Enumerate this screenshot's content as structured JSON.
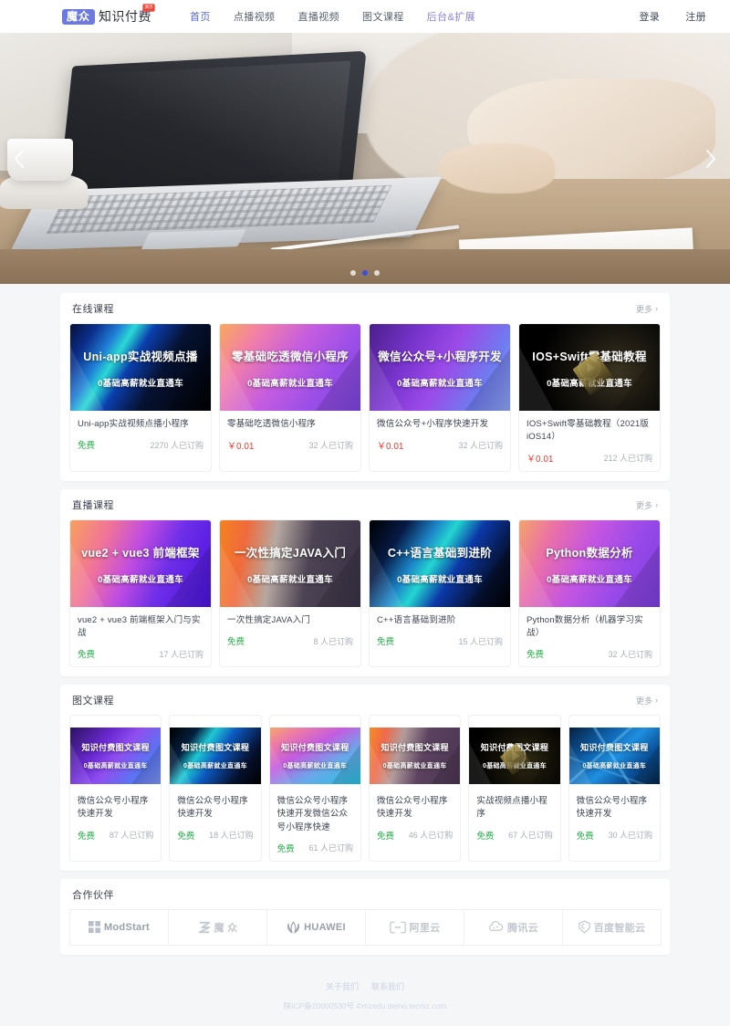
{
  "header": {
    "brand_mark": "魔众",
    "brand_name": "知识付费",
    "brand_badge": "演示",
    "nav": [
      {
        "label": "首页",
        "state": "active"
      },
      {
        "label": "点播视频",
        "state": "normal"
      },
      {
        "label": "直播视频",
        "state": "normal"
      },
      {
        "label": "图文课程",
        "state": "normal"
      },
      {
        "label": "后台&扩展",
        "state": "accent"
      }
    ],
    "auth": [
      {
        "label": "登录"
      },
      {
        "label": "注册"
      }
    ]
  },
  "hero": {
    "prev_icon": "chevron-left-icon",
    "next_icon": "chevron-right-icon",
    "dots": 3,
    "active_dot": 1
  },
  "sections": [
    {
      "title": "在线课程",
      "more_label": "更多",
      "more_icon": "chevron-right-icon",
      "cards": [
        {
          "thumb_title": "Uni-app实战视频点播",
          "thumb_sub": "0基础高薪就业直通车",
          "thumb_style": "g-uniapp",
          "name": "Uni-app实战视频点播小程序",
          "price": "免费",
          "price_type": "free",
          "orders": "2270 人已订购",
          "play": false
        },
        {
          "thumb_title": "零基础吃透微信小程序",
          "thumb_sub": "0基础高薪就业直通车",
          "thumb_style": "g-wx",
          "name": "零基础吃透微信小程序",
          "price": "￥0.01",
          "price_type": "paid",
          "orders": "32 人已订购",
          "play": false
        },
        {
          "thumb_title": "微信公众号+小程序开发",
          "thumb_sub": "0基础高薪就业直通车",
          "thumb_style": "g-wxmp",
          "name": "微信公众号+小程序快速开发",
          "price": "￥0.01",
          "price_type": "paid",
          "orders": "32 人已订购",
          "play": false
        },
        {
          "thumb_title": "IOS+Swift零基础教程",
          "thumb_sub": "0基础高薪就业直通车",
          "thumb_style": "g-ios",
          "name": "IOS+Swift零基础教程（2021版iOS14）",
          "price": "￥0.01",
          "price_type": "paid",
          "orders": "212 人已订购",
          "play": true
        }
      ]
    },
    {
      "title": "直播课程",
      "more_label": "更多",
      "more_icon": "chevron-right-icon",
      "cards": [
        {
          "thumb_title": "vue2 + vue3 前端框架",
          "thumb_sub": "0基础高薪就业直通车",
          "thumb_style": "g-vue",
          "name": "vue2 + vue3 前端框架入门与实战",
          "price": "免费",
          "price_type": "free",
          "orders": "17 人已订购",
          "play": false
        },
        {
          "thumb_title": "一次性搞定JAVA入门",
          "thumb_sub": "0基础高薪就业直通车",
          "thumb_style": "g-java",
          "name": "一次性搞定JAVA入门",
          "price": "免费",
          "price_type": "free",
          "orders": "8 人已订购",
          "play": false
        },
        {
          "thumb_title": "C++语言基础到进阶",
          "thumb_sub": "0基础高薪就业直通车",
          "thumb_style": "g-cpp",
          "name": "C++语言基础到进阶",
          "price": "免费",
          "price_type": "free",
          "orders": "15 人已订购",
          "play": false
        },
        {
          "thumb_title": "Python数据分析",
          "thumb_sub": "0基础高薪就业直通车",
          "thumb_style": "g-python",
          "name": "Python数据分析（机器学习实战）",
          "price": "免费",
          "price_type": "free",
          "orders": "32 人已订购",
          "play": false
        }
      ]
    },
    {
      "title": "图文课程",
      "more_label": "更多",
      "more_icon": "chevron-right-icon",
      "cards": [
        {
          "thumb_title": "知识付费图文课程",
          "thumb_sub": "0基础高薪就业直通车",
          "thumb_style": "g-it1",
          "name": "微信公众号小程序快速开发",
          "price": "免费",
          "price_type": "free",
          "orders": "87 人已订购",
          "play": false
        },
        {
          "thumb_title": "知识付费图文课程",
          "thumb_sub": "0基础高薪就业直通车",
          "thumb_style": "g-it2",
          "name": "微信公众号小程序快速开发",
          "price": "免费",
          "price_type": "free",
          "orders": "18 人已订购",
          "play": false
        },
        {
          "thumb_title": "知识付费图文课程",
          "thumb_sub": "0基础高薪就业直通车",
          "thumb_style": "g-it3",
          "name": "微信公众号小程序快速开发微信公众号小程序快速",
          "price": "免费",
          "price_type": "free",
          "orders": "61 人已订购",
          "play": false
        },
        {
          "thumb_title": "知识付费图文课程",
          "thumb_sub": "0基础高薪就业直通车",
          "thumb_style": "g-it4",
          "name": "微信公众号小程序快速开发",
          "price": "免费",
          "price_type": "free",
          "orders": "46 人已订购",
          "play": false
        },
        {
          "thumb_title": "知识付费图文课程",
          "thumb_sub": "0基础高薪就业直通车",
          "thumb_style": "g-it5",
          "name": "实战视频点播小程序",
          "price": "免费",
          "price_type": "free",
          "orders": "67 人已订购",
          "play": true
        },
        {
          "thumb_title": "知识付费图文课程",
          "thumb_sub": "0基础高薪就业直通车",
          "thumb_style": "g-it6",
          "name": "微信公众号小程序快速开发",
          "price": "免费",
          "price_type": "free",
          "orders": "30 人已订购",
          "play": false
        }
      ]
    }
  ],
  "partners": {
    "title": "合作伙伴",
    "items": [
      {
        "label": "ModStart",
        "icon": "modstart-grid-icon"
      },
      {
        "label": "魔 众",
        "icon": "mozhong-z-icon"
      },
      {
        "label": "HUAWEI",
        "icon": "huawei-flower-icon"
      },
      {
        "label": "阿里云",
        "icon": "aliyun-bracket-icon"
      },
      {
        "label": "腾讯云",
        "icon": "tencent-cloud-icon"
      },
      {
        "label": "百度智能云",
        "icon": "baidu-cloud-icon"
      }
    ]
  },
  "footer": {
    "links": [
      {
        "label": "关于我们"
      },
      {
        "label": "联系我们"
      }
    ],
    "copyright": "陕ICP备20000530号 ©mzedu.demo.tecmz.com"
  },
  "colors": {
    "accent": "#5468e0",
    "brand": "#6c7ae0",
    "free": "#27b04b",
    "paid": "#ef3b2f",
    "badge": "#e8463a"
  }
}
